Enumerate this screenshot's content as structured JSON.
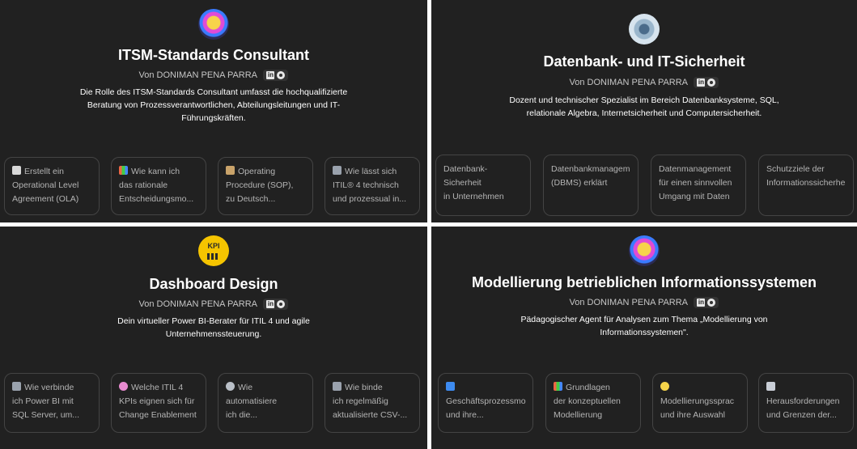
{
  "panels": [
    {
      "title": "ITSM-Standards Consultant",
      "byline": "Von DONIMAN PENA PARRA",
      "description": "Die Rolle des ITSM-Standards Consultant umfasst die hochqualifizierte\nBeratung von Prozessverantwortlichen, Abteilungsleitungen und IT-\nFührungskräften.",
      "avatar_icon": "lightbulb-brain-icon",
      "starters": [
        {
          "icon": "document-icon",
          "text": "Erstellt ein\nOperational Level\nAgreement (OLA)"
        },
        {
          "icon": "bar-chart-icon",
          "text": "Wie kann ich\ndas rationale\nEntscheidungsmo..."
        },
        {
          "icon": "clipboard-icon",
          "text": "Operating\nProcedure (SOP),\nzu Deutsch..."
        },
        {
          "icon": "tools-icon",
          "text": "Wie lässt sich\nITIL® 4 technisch\nund prozessual in..."
        }
      ]
    },
    {
      "title": "Datenbank- und IT-Sicherheit",
      "byline": "Von DONIMAN PENA PARRA",
      "description": "Dozent und technischer Spezialist im Bereich Datenbanksysteme, SQL,\nrelationale Algebra, Internetsicherheit und Computersicherheit.",
      "avatar_icon": "database-robot-icon",
      "starters": [
        {
          "icon": "",
          "text": "Datenbank-\nSicherheit\nin Unternehmen"
        },
        {
          "icon": "",
          "text": "Datenbankmanagem\n(DBMS) erklärt"
        },
        {
          "icon": "",
          "text": "Datenmanagement\nfür einen sinnvollen\nUmgang mit Daten"
        },
        {
          "icon": "",
          "text": "Schutzziele der\nInformationssicherhe"
        }
      ]
    },
    {
      "title": "Dashboard Design",
      "byline": "Von DONIMAN PENA PARRA",
      "description": "Dein virtueller Power BI-Berater für ITIL 4 und agile\nUnternehmenssteuerung.",
      "avatar_icon": "kpi-icon",
      "avatar_text": "KPI",
      "starters": [
        {
          "icon": "link-icon",
          "text": "Wie verbinde\nich Power BI mit\nSQL Server, um..."
        },
        {
          "icon": "brain-icon",
          "text": "Welche ITIL 4\nKPIs eignen sich für\nChange Enablement"
        },
        {
          "icon": "gear-icon",
          "text": "Wie\nautomatisiere\nich die..."
        },
        {
          "icon": "link-icon",
          "text": "Wie binde\nich regelmäßig\naktualisierte CSV-..."
        }
      ]
    },
    {
      "title": "Modellierung betrieblichen Informationssystemen",
      "byline": "Von DONIMAN PENA PARRA",
      "description": "Pädagogischer Agent für Analysen zum Thema „Modellierung von\nInformationssystemen\".",
      "avatar_icon": "lightbulb-brain-icon",
      "starters": [
        {
          "icon": "refresh-icon",
          "text": "\nGeschäftsprozessmo\nund ihre..."
        },
        {
          "icon": "bar-chart-icon",
          "text": "Grundlagen\nder konzeptuellen\nModellierung"
        },
        {
          "icon": "bulb-icon",
          "text": "\nModellierungssprac\nund ihre Auswahl"
        },
        {
          "icon": "trend-chart-icon",
          "text": "\nHerausforderungen\nund Grenzen der..."
        }
      ]
    }
  ],
  "colors": {
    "panel_bg": "#212121",
    "card_border": "#444444",
    "accent_kpi": "#f5c400"
  }
}
